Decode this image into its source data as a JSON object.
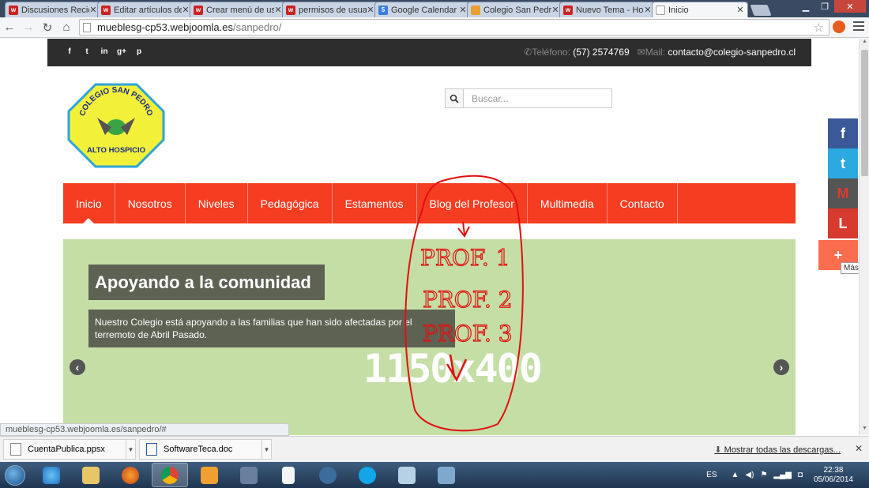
{
  "browser": {
    "tabs": [
      {
        "title": "Discusiones Recie",
        "favicon": "w",
        "active": false
      },
      {
        "title": "Editar artículos de",
        "favicon": "w",
        "active": false
      },
      {
        "title": "Crear menú de usu",
        "favicon": "w",
        "active": false
      },
      {
        "title": "permisos de usuar",
        "favicon": "w",
        "active": false
      },
      {
        "title": "Google Calendar",
        "favicon": "cal",
        "active": false
      },
      {
        "title": "Colegio San Pedro",
        "favicon": "school",
        "active": false
      },
      {
        "title": "Nuevo Tema - Ho",
        "favicon": "w",
        "active": false
      },
      {
        "title": "Inicio",
        "favicon": "page",
        "active": true
      }
    ],
    "url_host": "mueblesg-cp53.webjoomla.es",
    "url_path": "/sanpedro/",
    "status_url": "mueblesg-cp53.webjoomla.es/sanpedro/#"
  },
  "site": {
    "social_icons": [
      "f",
      "t",
      "in",
      "g+",
      "p"
    ],
    "phone_label": "Teléfono:",
    "phone": "(57) 2574769",
    "mail_label": "Mail:",
    "mail": "contacto@colegio-sanpedro.cl",
    "logo_top": "COLEGIO SAN PEDRO",
    "logo_bottom": "ALTO HOSPICIO",
    "search_placeholder": "Buscar...",
    "nav": [
      "Inicio",
      "Nosotros",
      "Niveles",
      "Pedagógica",
      "Estamentos",
      "Blog del Profesor",
      "Multimedia",
      "Contacto"
    ],
    "slide_title": "Apoyando a la comunidad",
    "slide_text": "Nuestro Colegio está apoyando a las familias que han sido afectadas por el terremoto de Abril Pasado.",
    "slide_placeholder": "1150x400",
    "prev": "‹",
    "next": "›",
    "share_more_tooltip": "Más..."
  },
  "annotation": {
    "lines": [
      "PROF. 1",
      "PROF. 2",
      "PROF. 3"
    ],
    "color": "#e01010"
  },
  "downloads": {
    "items": [
      "CuentaPublica.ppsx",
      "SoftwareTeca.doc"
    ],
    "show_all": "Mostrar todas las descargas..."
  },
  "taskbar": {
    "lang": "ES",
    "time": "22:38",
    "date": "05/06/2014"
  },
  "colors": {
    "nav_bg": "#f53d22",
    "slider_bg": "#c4dea5",
    "topbar_bg": "#2d2d2d"
  }
}
